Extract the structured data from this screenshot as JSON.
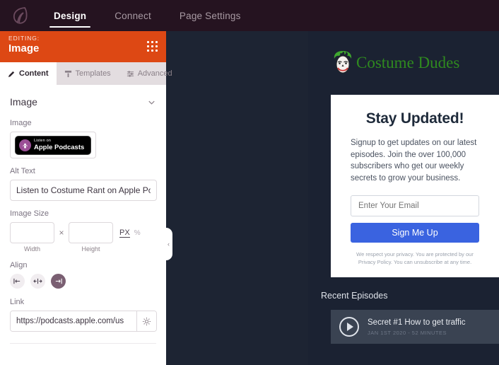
{
  "topnav": {
    "logo_icon": "leaf-logo-icon",
    "tabs": [
      {
        "label": "Design",
        "active": true
      },
      {
        "label": "Connect",
        "active": false
      },
      {
        "label": "Page Settings",
        "active": false
      }
    ]
  },
  "sidebar": {
    "editing": {
      "eyebrow": "EDITING:",
      "title": "Image",
      "handle_icon": "grid-drag-handle-icon"
    },
    "tabs": [
      {
        "label": "Content",
        "icon": "pencil-icon",
        "active": true
      },
      {
        "label": "Templates",
        "icon": "template-icon",
        "active": false
      },
      {
        "label": "Advanced",
        "icon": "sliders-icon",
        "active": false
      }
    ],
    "section": {
      "title": "Image",
      "chevron_icon": "chevron-down-icon"
    },
    "fields": {
      "image_label": "Image",
      "image_thumb": {
        "line1": "Listen on",
        "line2": "Apple Podcasts",
        "icon": "apple-podcasts-icon"
      },
      "alt_text_label": "Alt Text",
      "alt_text_value": "Listen to Costume Rant on Apple Po",
      "image_size_label": "Image Size",
      "width_value": "",
      "height_value": "",
      "width_sublabel": "Width",
      "height_sublabel": "Height",
      "times_symbol": "×",
      "unit_px": "PX",
      "unit_percent": "%",
      "align_label": "Align",
      "align_options": [
        {
          "name": "align-left",
          "selected": false
        },
        {
          "name": "align-center",
          "selected": false
        },
        {
          "name": "align-right",
          "selected": true
        }
      ],
      "link_label": "Link",
      "link_value": "https://podcasts.apple.com/us",
      "link_settings_icon": "gear-icon"
    }
  },
  "collapse_handle": {
    "icon": "chevron-left-icon",
    "glyph": "‹"
  },
  "preview": {
    "site_name": "Costume Dudes",
    "logo_icon": "joker-face-icon",
    "card": {
      "heading": "Stay Updated!",
      "description": "Signup to get updates on our latest episodes. Join the over 100,000 subscribers who get our weekly secrets to grow your business.",
      "email_placeholder": "Enter Your Email",
      "email_value": "",
      "button_label": "Sign Me Up",
      "privacy_note": "We respect your privacy. You are protected by our Privacy Policy. You can unsubscribe at any time."
    },
    "recent": {
      "title": "Recent Episodes",
      "episodes": [
        {
          "title": "Secret #1 How to get traffic",
          "meta": "JAN 1ST 2020 - 52 MINUTES",
          "play_icon": "play-circle-icon"
        }
      ]
    }
  },
  "colors": {
    "topnav_bg": "#251320",
    "editing_orange": "#dd4814",
    "canvas_dark": "#1d2433",
    "accent_purple": "#7a5f72",
    "signup_blue": "#3a63e0",
    "brand_green": "#2f8a1f",
    "episode_bg": "#3a4352"
  }
}
